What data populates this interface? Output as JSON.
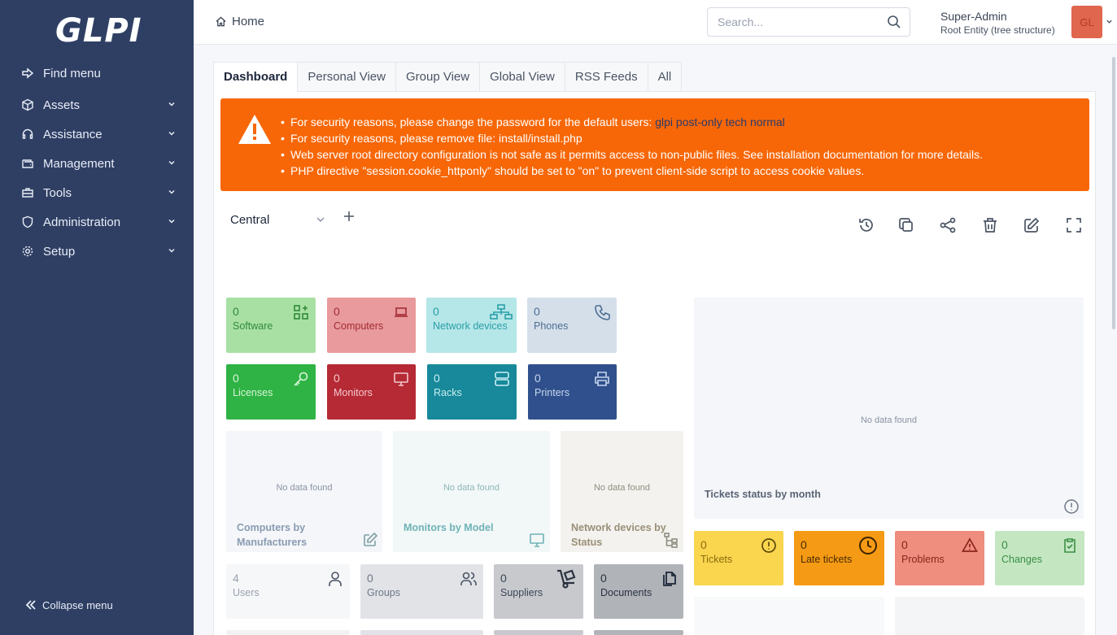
{
  "sidebar": {
    "logo": "GLPI",
    "items": [
      {
        "label": "Find menu",
        "icon": "arrow-right-icon"
      },
      {
        "label": "Assets",
        "icon": "package-icon"
      },
      {
        "label": "Assistance",
        "icon": "headset-icon"
      },
      {
        "label": "Management",
        "icon": "wallet-icon"
      },
      {
        "label": "Tools",
        "icon": "briefcase-icon"
      },
      {
        "label": "Administration",
        "icon": "shield-icon"
      },
      {
        "label": "Setup",
        "icon": "gear-icon"
      }
    ],
    "collapse_label": "Collapse menu"
  },
  "header": {
    "breadcrumb": "Home",
    "search_placeholder": "Search...",
    "user_name": "Super-Admin",
    "user_entity": "Root Entity (tree structure)",
    "avatar_initials": "GL"
  },
  "tabs": [
    "Dashboard",
    "Personal View",
    "Group View",
    "Global View",
    "RSS Feeds",
    "All"
  ],
  "alert": {
    "line1_prefix": "For security reasons, please change the password for the default users: ",
    "line1_users": "glpi post-only tech normal",
    "line2": "For security reasons, please remove file: install/install.php",
    "line3": "Web server root directory configuration is not safe as it permits access to non-public files. See installation documentation for more details.",
    "line4": "PHP directive \"session.cookie_httponly\" should be set to \"on\" to prevent client-side script to access cookie values."
  },
  "dashboard": {
    "selected": "Central"
  },
  "cards": {
    "software": {
      "value": "0",
      "label": "Software"
    },
    "computers": {
      "value": "0",
      "label": "Computers"
    },
    "network_devices": {
      "value": "0",
      "label": "Network devices"
    },
    "phones": {
      "value": "0",
      "label": "Phones"
    },
    "licenses": {
      "value": "0",
      "label": "Licenses"
    },
    "monitors": {
      "value": "0",
      "label": "Monitors"
    },
    "racks": {
      "value": "0",
      "label": "Racks"
    },
    "printers": {
      "value": "0",
      "label": "Printers"
    },
    "users": {
      "value": "4",
      "label": "Users"
    },
    "groups": {
      "value": "0",
      "label": "Groups"
    },
    "suppliers": {
      "value": "0",
      "label": "Suppliers"
    },
    "documents": {
      "value": "0",
      "label": "Documents"
    },
    "tickets": {
      "value": "0",
      "label": "Tickets"
    },
    "late_tickets": {
      "value": "0",
      "label": "Late tickets"
    },
    "problems": {
      "value": "0",
      "label": "Problems"
    },
    "changes": {
      "value": "0",
      "label": "Changes"
    }
  },
  "widgets": {
    "no_data": "No data found",
    "computers_by_manufacturers": "Computers by Manufacturers",
    "monitors_by_model": "Monitors by Model",
    "network_devices_by_status": "Network devices by Status",
    "tickets_status_by_month": "Tickets status by month"
  }
}
